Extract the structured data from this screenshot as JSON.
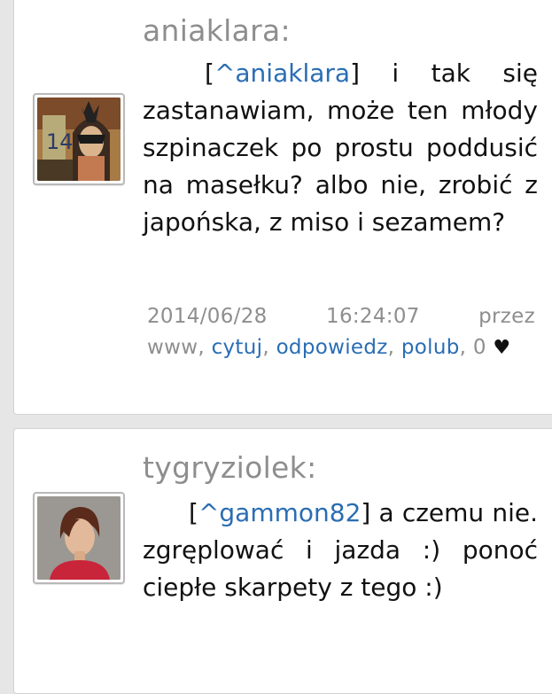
{
  "comments": [
    {
      "username": "aniaklara:",
      "mention": "^aniaklara",
      "text": " i tak się zastanawiam, może ten młody szpinaczek po prostu poddusić na masełku? albo nie, zrobić z japońska, z miso i sezamem?",
      "date": "2014/06/28",
      "time": "16:24:07",
      "via": "przez www,",
      "actions": {
        "quote": "cytuj",
        "reply": "odpowiedz",
        "like": "polub"
      },
      "likes": "0",
      "heart": "♥"
    },
    {
      "username": "tygryziolek:",
      "mention": "^gammon82",
      "text": " a czemu nie. zgręplować i jazda :) ponoć ciepłe skarpety z tego :)"
    }
  ],
  "colors": {
    "link": "#2a6db4",
    "muted": "#8e8e8e",
    "text": "#111111",
    "background": "#e6e6e6"
  }
}
